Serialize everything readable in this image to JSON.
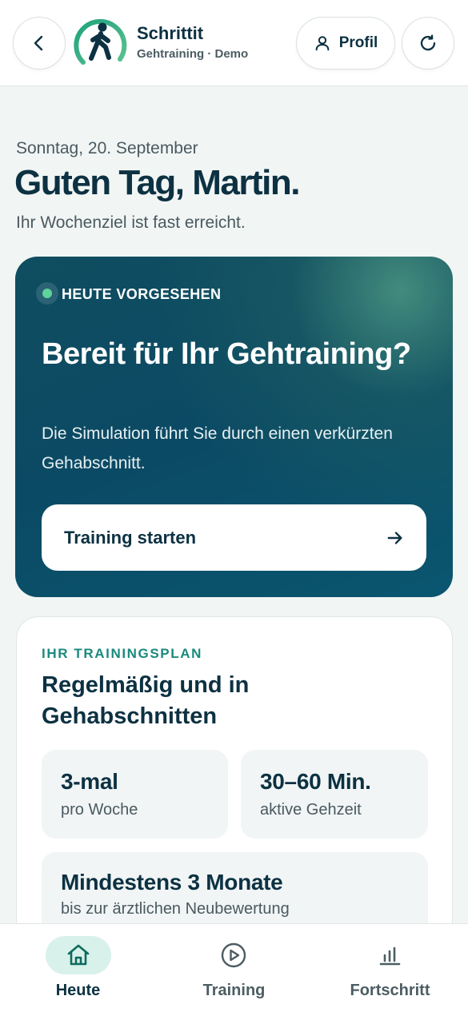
{
  "header": {
    "app_name": "Schrittit",
    "app_subtitle": "Gehtraining · Demo",
    "profile_label": "Profil"
  },
  "greeting": {
    "date": "Sonntag, 20. September",
    "title": "Guten Tag, Martin.",
    "subtitle": "Ihr Wochenziel ist fast erreicht."
  },
  "today_card": {
    "badge": "HEUTE VORGESEHEN",
    "title": "Bereit für Ihr Gehtraining?",
    "description": "Die Simulation führt Sie durch einen verkürzten Gehabschnitt.",
    "cta_label": "Training starten"
  },
  "plan_card": {
    "eyebrow": "IHR TRAININGSPLAN",
    "title": "Regelmäßig und in Gehabschnitten",
    "stats": [
      {
        "value": "3-mal",
        "label": "pro Woche"
      },
      {
        "value": "30–60 Min.",
        "label": "aktive Gehzeit"
      },
      {
        "value": "Mindestens 3 Monate",
        "label": "bis zur ärztlichen Neubewertung"
      }
    ]
  },
  "bottom_nav": {
    "items": [
      {
        "label": "Heute",
        "icon": "home-icon",
        "active": true
      },
      {
        "label": "Training",
        "icon": "play-circle-icon",
        "active": false
      },
      {
        "label": "Fortschritt",
        "icon": "bar-chart-icon",
        "active": false
      }
    ]
  },
  "colors": {
    "primary_dark": "#0c3142",
    "accent_teal": "#1a8a7c",
    "status_green": "#5fd49a",
    "nav_active_bg": "#d8f1eb"
  }
}
